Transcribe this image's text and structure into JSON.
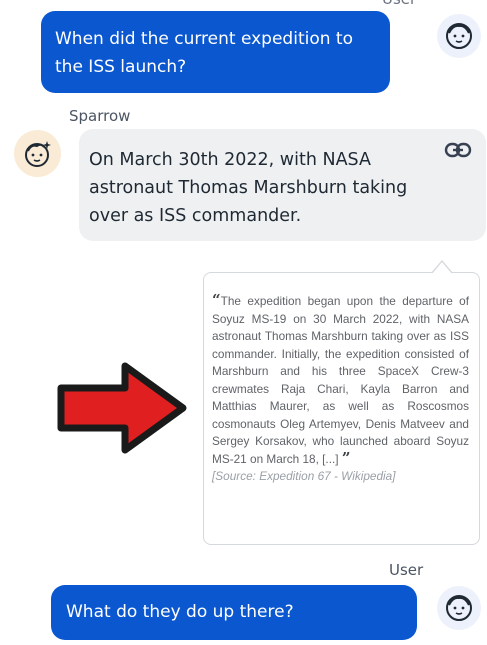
{
  "header": {
    "top_label": "User"
  },
  "conversation": {
    "user_message_1": "When did the current expedition to the ISS launch?",
    "bot_name": "Sparrow",
    "bot_message": "On March 30th 2022, with NASA astronaut Thomas Marshburn taking over as ISS commander.",
    "quote": {
      "open_mark": "“",
      "text": "The expedition began upon the departure of Soyuz MS-19 on 30 March 2022, with NASA astronaut Thomas Marshburn taking over as ISS commander. Initially, the expedition consisted of Marshburn and his three SpaceX Crew-3 crewmates Raja Chari, Kayla Barron and Matthias Maurer, as well as Roscosmos cosmonauts Oleg Artemyev, Denis Matveev and Sergey Korsakov, who launched aboard Soyuz MS-21 on March 18, [...]",
      "close_mark": "”",
      "source": "[Source: Expedition 67 - Wikipedia]"
    },
    "user_name_2": "User",
    "user_message_2": "What do they do up there?"
  },
  "icons": {
    "user_avatar": "user-face-icon",
    "bot_avatar": "bot-face-icon",
    "link": "link-icon",
    "arrow": "red-arrow-icon"
  },
  "colors": {
    "user_bubble": "#0b57d0",
    "bot_bubble": "#eef0f2",
    "user_avatar_bg": "#edf1fb",
    "bot_avatar_bg": "#f9ebd6",
    "arrow": "#e02020"
  }
}
